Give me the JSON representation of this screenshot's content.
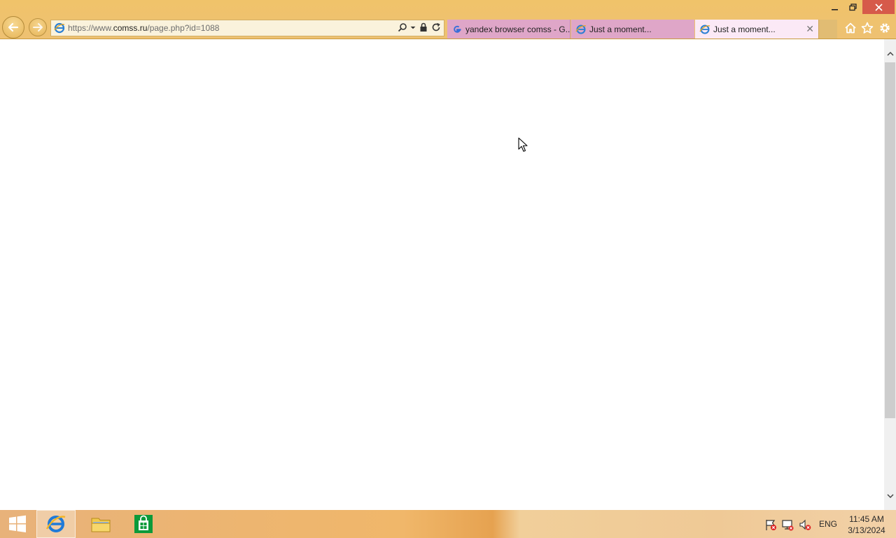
{
  "browser": {
    "address": {
      "scheme": "https://www.",
      "host": "comss.ru",
      "path": "/page.php?id=1088"
    },
    "tabs": [
      {
        "label": "yandex browser comss - G...",
        "favicon": "google-icon",
        "active": false
      },
      {
        "label": "Just a moment...",
        "favicon": "ie-icon",
        "active": false
      },
      {
        "label": "Just a moment...",
        "favicon": "ie-icon",
        "active": true
      }
    ]
  },
  "taskbar": {
    "language": "ENG",
    "time": "11:45 AM",
    "date": "3/13/2024"
  },
  "colors": {
    "chrome": "#f0c36a",
    "active_tab": "#fbe9f6",
    "inactive_tab": "#dfa6c8",
    "close_button": "#d65a4a"
  }
}
